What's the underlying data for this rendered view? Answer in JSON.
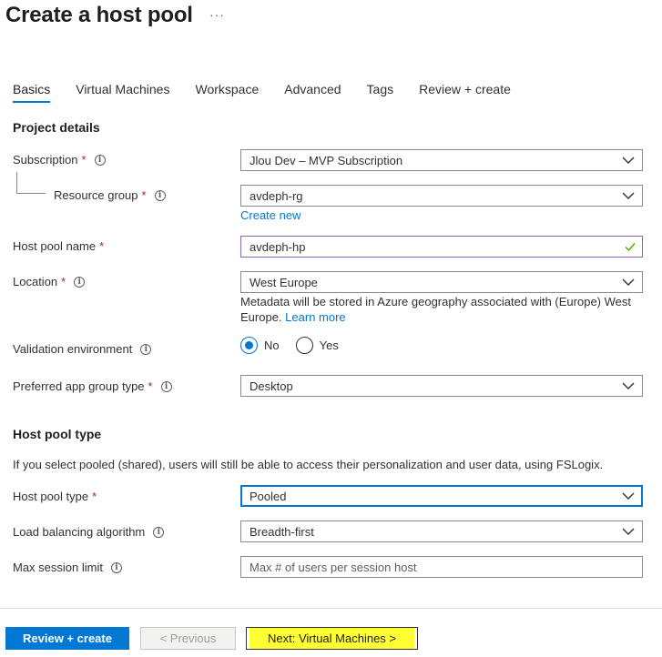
{
  "header": {
    "title": "Create a host pool",
    "more": "···"
  },
  "tabs": [
    {
      "label": "Basics"
    },
    {
      "label": "Virtual Machines"
    },
    {
      "label": "Workspace"
    },
    {
      "label": "Advanced"
    },
    {
      "label": "Tags"
    },
    {
      "label": "Review + create"
    }
  ],
  "project": {
    "heading": "Project details",
    "subscription": {
      "label": "Subscription",
      "value": "Jlou Dev – MVP Subscription"
    },
    "resource_group": {
      "label": "Resource group",
      "value": "avdeph-rg",
      "create_new": "Create new"
    },
    "host_pool_name": {
      "label": "Host pool name",
      "value": "avdeph-hp"
    },
    "location": {
      "label": "Location",
      "value": "West Europe",
      "help": "Metadata will be stored in Azure geography associated with (Europe) West Europe.",
      "learn_more": "Learn more"
    },
    "validation": {
      "label": "Validation environment",
      "option_no": "No",
      "option_yes": "Yes",
      "selected": "No"
    },
    "app_group": {
      "label": "Preferred app group type",
      "value": "Desktop"
    }
  },
  "pool_type": {
    "heading": "Host pool type",
    "description": "If you select pooled (shared), users will still be able to access their personalization and user data, using FSLogix.",
    "host_pool_type": {
      "label": "Host pool type",
      "value": "Pooled"
    },
    "load_balancing": {
      "label": "Load balancing algorithm",
      "value": "Breadth-first"
    },
    "max_session": {
      "label": "Max session limit",
      "placeholder": "Max # of users per session host"
    }
  },
  "footer": {
    "review": "Review + create",
    "previous": "< Previous",
    "next": "Next: Virtual Machines >"
  },
  "colors": {
    "accent": "#0078d4",
    "required": "#a4262c",
    "highlight": "#ffff33"
  },
  "req_mark": "*",
  "info_glyph": "i"
}
